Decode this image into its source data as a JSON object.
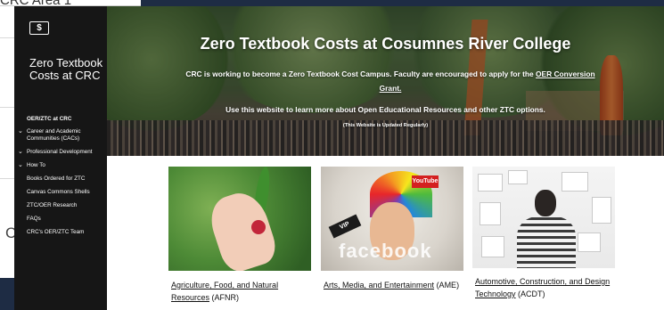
{
  "background": {
    "breadcrumb": "CRC Area 1",
    "partial_letter": "C"
  },
  "sidebar": {
    "logo_glyph": "$",
    "site_title": "Zero Textbook Costs at CRC",
    "nav_heading": "OER/ZTC at CRC",
    "items": [
      {
        "label": "Career and Academic Communities (CACs)",
        "chevron": "⌄"
      },
      {
        "label": "Professional Development",
        "chevron": "⌄"
      },
      {
        "label": "How To",
        "chevron": "⌄"
      },
      {
        "label": "Books Ordered for ZTC",
        "chevron": ""
      },
      {
        "label": "Canvas Commons Shells",
        "chevron": ""
      },
      {
        "label": "ZTC/OER Research",
        "chevron": ""
      },
      {
        "label": "FAQs",
        "chevron": ""
      },
      {
        "label": "CRC's OER/ZTC Team",
        "chevron": ""
      }
    ]
  },
  "hero": {
    "title": "Zero Textbook Costs at Cosumnes River College",
    "line1_text": "CRC is working to become a Zero Textbook Cost Campus. Faculty are encouraged to apply for the ",
    "line1_link": "OER Conversion Grant.",
    "line2": "Use this website to learn more about Open Educational Resources and other ZTC options.",
    "line3": "(This Website is Updated Regularly)"
  },
  "cards": [
    {
      "link": "Agriculture, Food, and Natural Resources",
      "abbr": " (AFNR)"
    },
    {
      "link": "Arts, Media, and Entertainment",
      "abbr": " (AME)"
    },
    {
      "link": "Automotive, Construction, and Design Technology",
      "abbr": " (ACDT)"
    }
  ],
  "image_text": {
    "youtube": "YouTube",
    "vip": "VIP",
    "facebook": "facebook"
  }
}
